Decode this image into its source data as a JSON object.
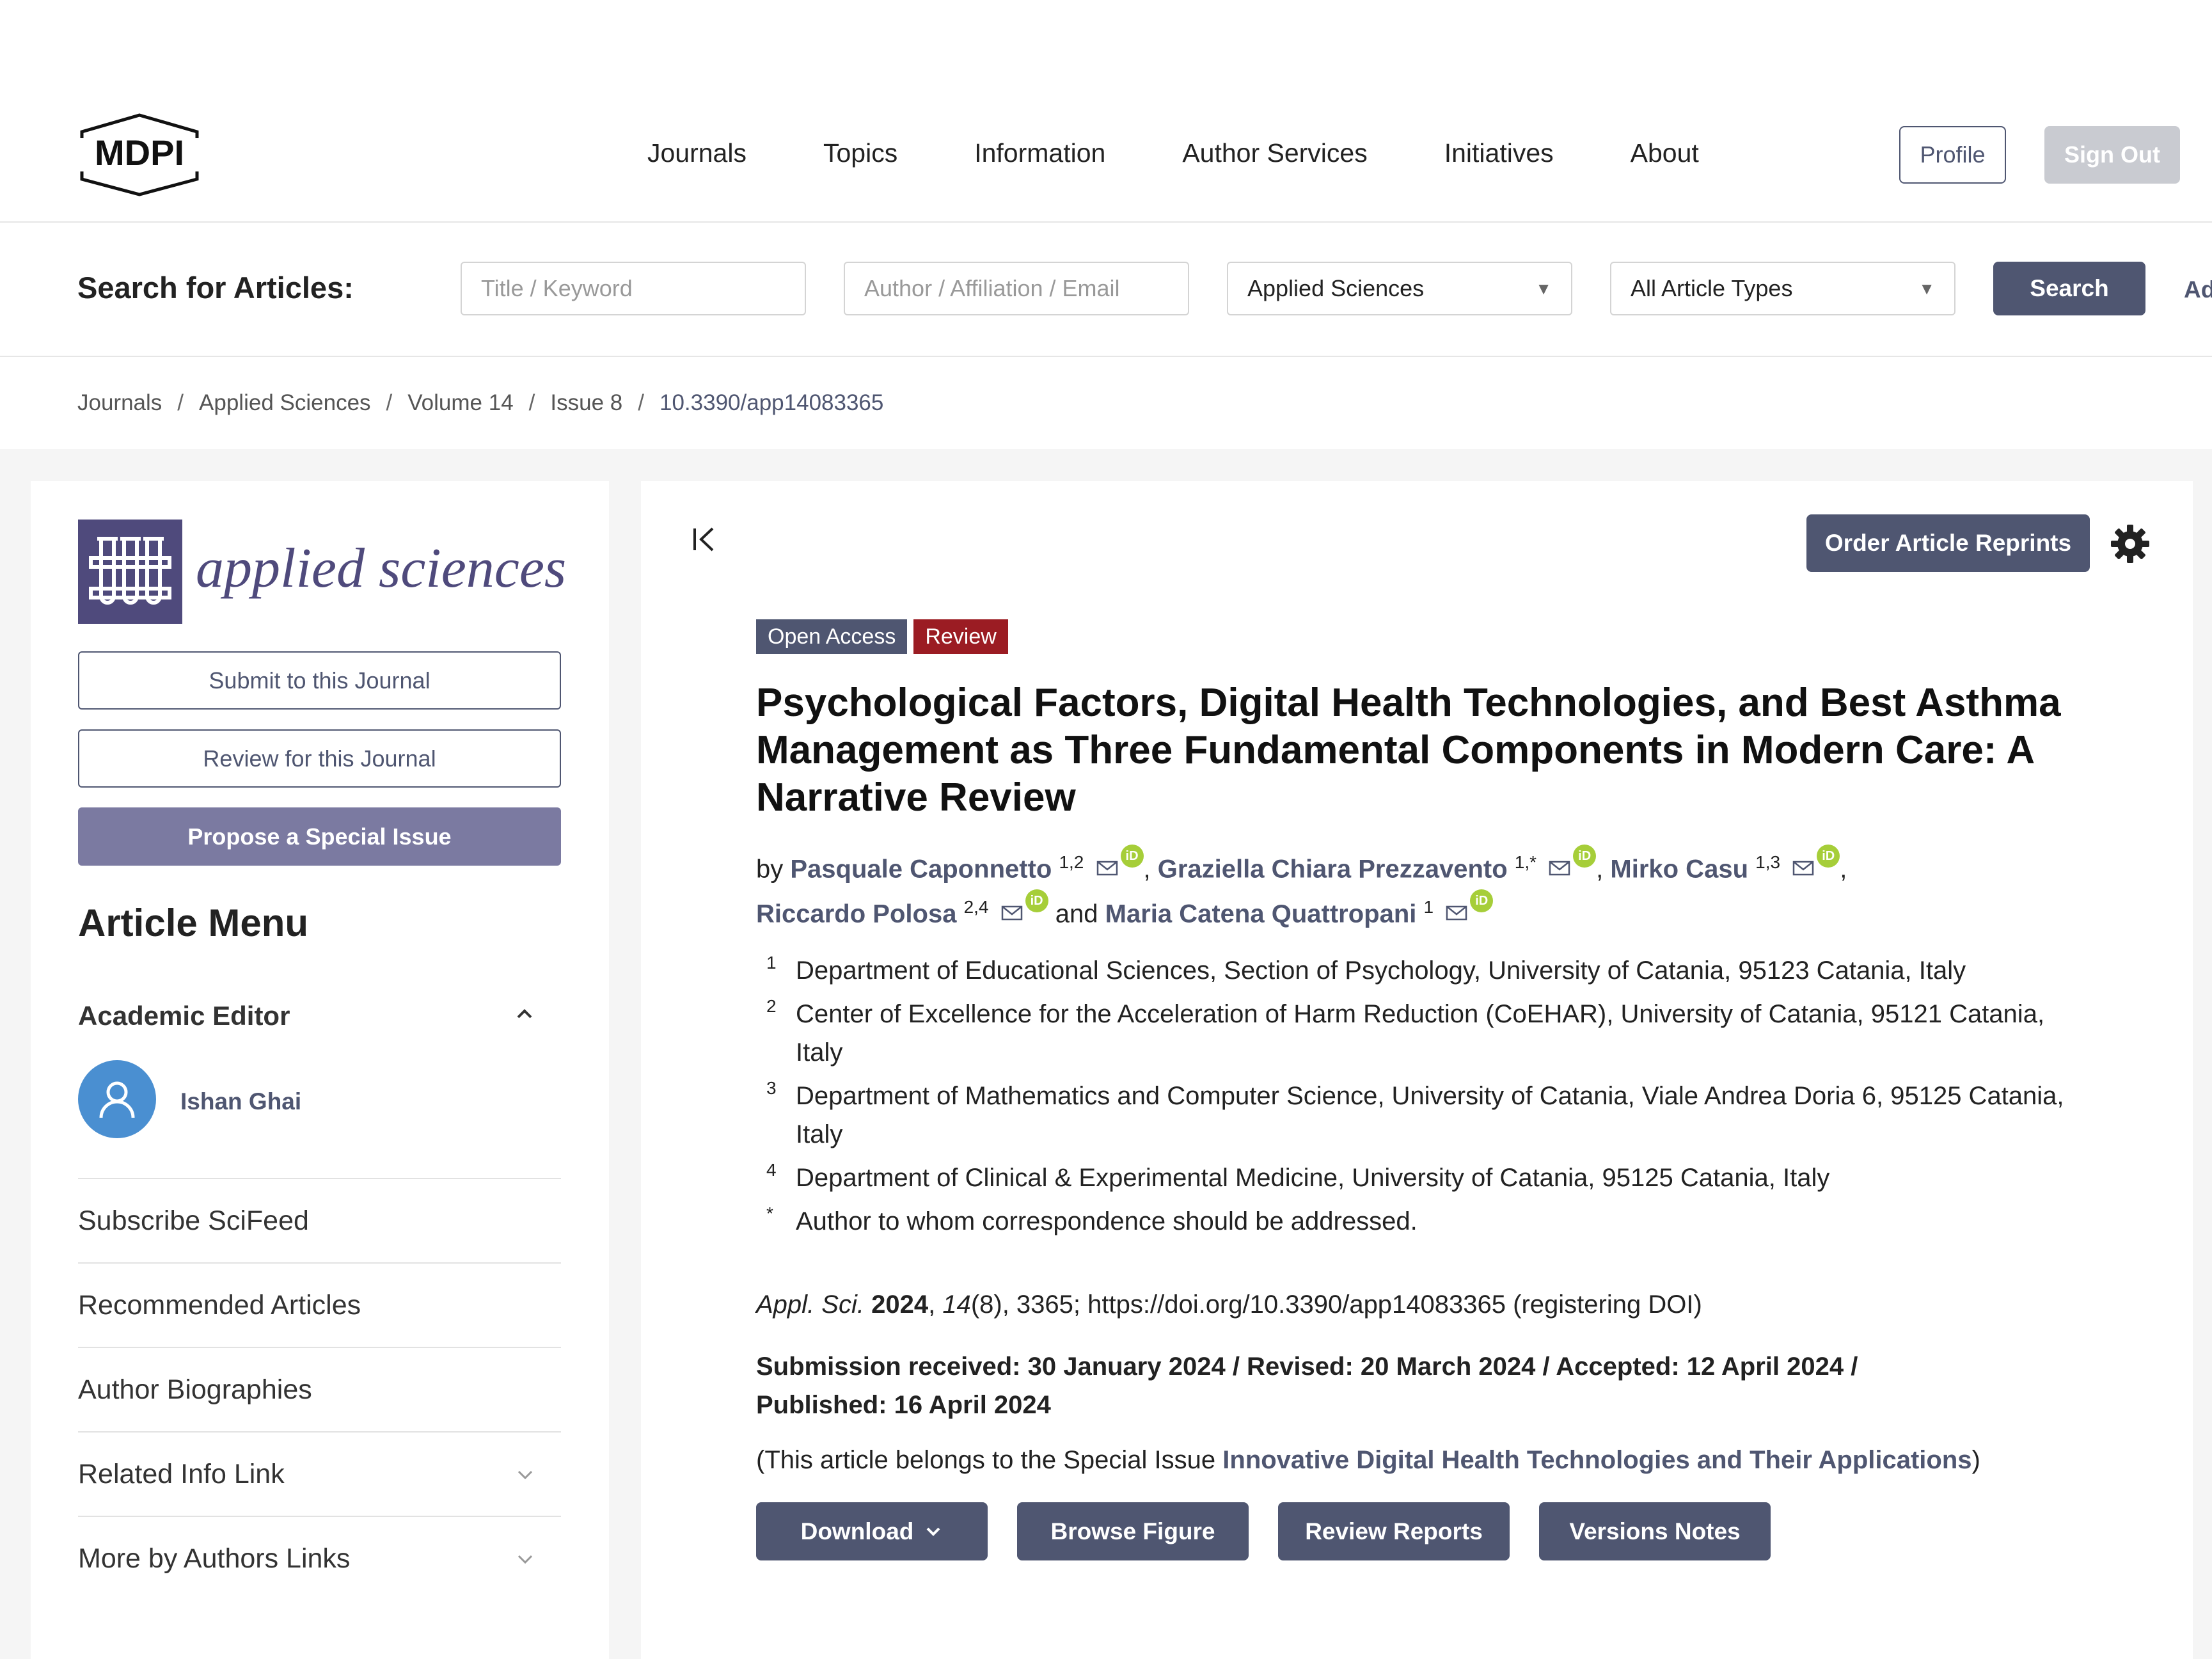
{
  "header": {
    "logo_text": "MDPI",
    "nav": [
      "Journals",
      "Topics",
      "Information",
      "Author Services",
      "Initiatives",
      "About"
    ],
    "profile_label": "Profile",
    "signout_label": "Sign Out"
  },
  "search": {
    "label": "Search for Articles:",
    "keyword_placeholder": "Title / Keyword",
    "author_placeholder": "Author / Affiliation / Email",
    "journal_value": "Applied Sciences",
    "type_value": "All Article Types",
    "search_label": "Search",
    "advanced_label": "Ad"
  },
  "breadcrumb": [
    "Journals",
    "Applied Sciences",
    "Volume 14",
    "Issue 8",
    "10.3390/app14083365"
  ],
  "sidebar": {
    "journal_name": "applied sciences",
    "submit_label": "Submit to this Journal",
    "review_label": "Review for this Journal",
    "propose_label": "Propose a Special Issue",
    "menu_title": "Article Menu",
    "editor_title": "Academic Editor",
    "editor_name": "Ishan Ghai",
    "items": [
      "Subscribe SciFeed",
      "Recommended Articles",
      "Author Biographies",
      "Related Info Link",
      "More by Authors Links"
    ]
  },
  "article": {
    "reprints_label": "Order Article Reprints",
    "badge_open": "Open Access",
    "badge_type": "Review",
    "title": "Psychological Factors, Digital Health Technologies, and Best Asthma Management as Three Fundamental Components in Modern Care: A Narrative Review",
    "by": "by",
    "authors": [
      {
        "name": "Pasquale Caponnetto",
        "sup": "1,2"
      },
      {
        "name": "Graziella Chiara Prezzavento",
        "sup": "1,*"
      },
      {
        "name": "Mirko Casu",
        "sup": "1,3"
      },
      {
        "name": "Riccardo Polosa",
        "sup": "2,4"
      },
      {
        "name": "Maria Catena Quattropani",
        "sup": "1"
      }
    ],
    "and": "and",
    "orcid_label": "iD",
    "affiliations": [
      {
        "num": "1",
        "text": "Department of Educational Sciences, Section of Psychology, University of Catania, 95123 Catania, Italy"
      },
      {
        "num": "2",
        "text": "Center of Excellence for the Acceleration of Harm Reduction (CoEHAR), University of Catania, 95121 Catania, Italy"
      },
      {
        "num": "3",
        "text": "Department of Mathematics and Computer Science, University of Catania, Viale Andrea Doria 6, 95125 Catania, Italy"
      },
      {
        "num": "4",
        "text": "Department of Clinical & Experimental Medicine, University of Catania, 95125 Catania, Italy"
      },
      {
        "num": "*",
        "text": "Author to whom correspondence should be addressed."
      }
    ],
    "cite_journal": "Appl. Sci.",
    "cite_year": "2024",
    "cite_volume": "14",
    "cite_rest": "(8), 3365; https://doi.org/10.3390/app14083365 (registering DOI)",
    "dates": "Submission received: 30 January 2024 / Revised: 20 March 2024 / Accepted: 12 April 2024 / Published: 16 April 2024",
    "special_prefix": "(This article belongs to the Special Issue ",
    "special_link": "Innovative Digital Health Technologies and Their Applications",
    "special_suffix": ")",
    "actions": [
      "Download",
      "Browse Figure",
      "Review Reports",
      "Versions Notes"
    ]
  }
}
